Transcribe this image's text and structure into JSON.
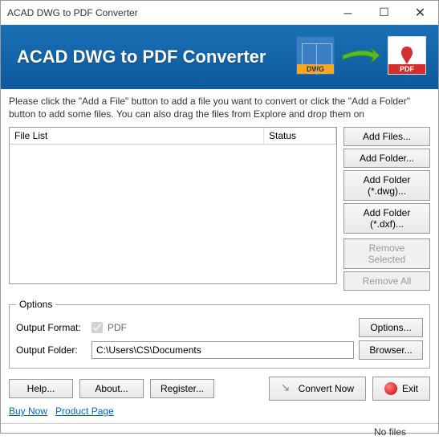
{
  "window": {
    "title": "ACAD DWG to PDF Converter"
  },
  "banner": {
    "title": "ACAD  DWG to PDF Converter",
    "dwg_label": "DWG",
    "pdf_label": "PDF"
  },
  "instructions": "Please click the \"Add a File\" button to add a file you want to convert or click the \"Add a Folder\" button to add some files. You can also drag the files from Explore and drop them on",
  "filelist": {
    "col_file": "File List",
    "col_status": "Status"
  },
  "buttons": {
    "add_files": "Add Files...",
    "add_folder": "Add Folder...",
    "add_folder_dwg": "Add Folder (*.dwg)...",
    "add_folder_dxf": "Add Folder (*.dxf)...",
    "remove_selected": "Remove Selected",
    "remove_all": "Remove All"
  },
  "options": {
    "legend": "Options",
    "output_format_label": "Output Format:",
    "output_format_value": "PDF",
    "output_folder_label": "Output Folder:",
    "output_folder_value": "C:\\Users\\CS\\Documents",
    "options_btn": "Options...",
    "browser_btn": "Browser..."
  },
  "bottom": {
    "help": "Help...",
    "about": "About...",
    "register": "Register...",
    "convert": "Convert Now",
    "exit": "Exit"
  },
  "links": {
    "buy": "Buy Now",
    "product": "Product Page"
  },
  "status": {
    "text": "No files"
  }
}
